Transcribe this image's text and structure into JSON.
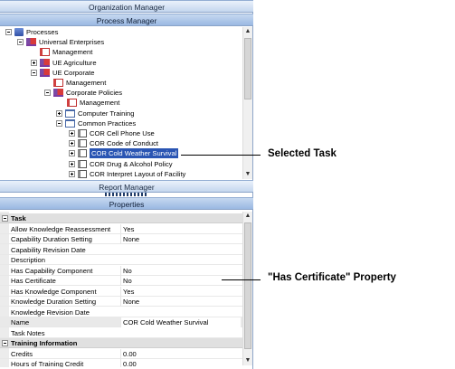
{
  "headers": {
    "organization_manager": "Organization Manager",
    "process_manager": "Process Manager",
    "report_manager": "Report Manager",
    "properties": "Properties"
  },
  "tree": [
    {
      "label": "Processes",
      "icon": "processes-icon",
      "toggle": "minus"
    },
    {
      "label": "Universal Enterprises",
      "icon": "enterprise-icon",
      "toggle": "minus"
    },
    {
      "label": "Management",
      "icon": "management-icon",
      "toggle": "none"
    },
    {
      "label": "UE Agriculture",
      "icon": "enterprise-icon",
      "toggle": "plus"
    },
    {
      "label": "UE Corporate",
      "icon": "enterprise-icon",
      "toggle": "minus"
    },
    {
      "label": "Management",
      "icon": "management-icon",
      "toggle": "none"
    },
    {
      "label": "Corporate Policies",
      "icon": "enterprise-icon",
      "toggle": "minus"
    },
    {
      "label": "Management",
      "icon": "management-icon",
      "toggle": "none"
    },
    {
      "label": "Computer Training",
      "icon": "folder-icon",
      "toggle": "plus"
    },
    {
      "label": "Common Practices",
      "icon": "folder-icon",
      "toggle": "minus"
    },
    {
      "label": "COR  Cell Phone Use",
      "icon": "task-icon",
      "toggle": "plus"
    },
    {
      "label": "COR  Code of Conduct",
      "icon": "task-icon",
      "toggle": "plus"
    },
    {
      "label": "COR  Cold Weather Survival",
      "icon": "task-icon",
      "toggle": "plus",
      "selected": true
    },
    {
      "label": "COR  Drug & Alcohol Policy",
      "icon": "task-icon",
      "toggle": "plus"
    },
    {
      "label": "COR  Interpret Layout of Facility",
      "icon": "task-icon",
      "toggle": "plus"
    }
  ],
  "properties": {
    "task_category": "Task",
    "task_rows": [
      {
        "name": "Allow Knowledge Reassessment",
        "value": "Yes"
      },
      {
        "name": "Capability Duration Setting",
        "value": "None"
      },
      {
        "name": "Capability Revision Date",
        "value": ""
      },
      {
        "name": "Description",
        "value": ""
      },
      {
        "name": "Has Capability Component",
        "value": "No"
      },
      {
        "name": "Has Certificate",
        "value": "No"
      },
      {
        "name": "Has Knowledge Component",
        "value": "Yes"
      },
      {
        "name": "Knowledge Duration Setting",
        "value": "None"
      },
      {
        "name": "Knowledge Revision Date",
        "value": ""
      },
      {
        "name": "Name",
        "value": "COR  Cold Weather Survival"
      },
      {
        "name": "Task Notes",
        "value": ""
      }
    ],
    "training_category": "Training Information",
    "training_rows": [
      {
        "name": "Credits",
        "value": "0.00"
      },
      {
        "name": "Hours of Training Credit",
        "value": "0.00"
      }
    ]
  },
  "callouts": {
    "selected_task": "Selected Task",
    "has_certificate": "\"Has Certificate\" Property"
  },
  "scroll_glyphs": {
    "up": "▲",
    "down": "▼"
  }
}
